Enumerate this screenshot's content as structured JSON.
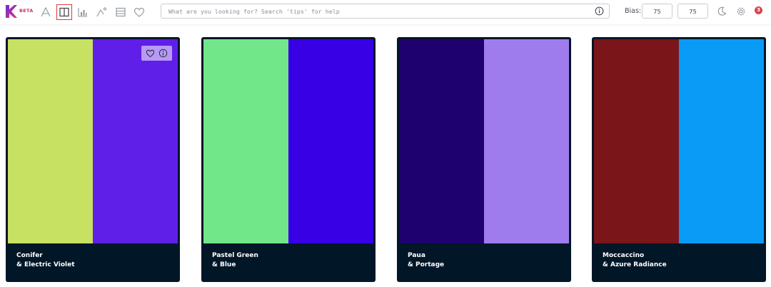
{
  "app": {
    "beta_label": "BETA",
    "brand_color": "#c8346a",
    "logo_icon": "k-logo-icon"
  },
  "toolbar": {
    "tools": [
      {
        "name": "typography-icon",
        "active": false
      },
      {
        "name": "two-column-palette-icon",
        "active": true
      },
      {
        "name": "chart-icon",
        "active": false
      },
      {
        "name": "gradient-icon",
        "active": false
      },
      {
        "name": "layout-icon",
        "active": false
      },
      {
        "name": "heart-icon",
        "active": false
      }
    ]
  },
  "search": {
    "placeholder": "What are you looking for? Search 'tips' for help",
    "value": ""
  },
  "bias": {
    "label": "Bias:",
    "value1": "75",
    "value2": "75"
  },
  "header_right": {
    "notification_count": "3",
    "badge_color": "#d9444d"
  },
  "cards": [
    {
      "name_line1": "Conifer",
      "name_line2": "& Electric Violet",
      "colors": [
        "#c7e162",
        "#5f1fe8"
      ],
      "show_actions": true
    },
    {
      "name_line1": "Pastel Green",
      "name_line2": "& Blue",
      "colors": [
        "#72e789",
        "#3800e5"
      ],
      "show_actions": false
    },
    {
      "name_line1": "Paua",
      "name_line2": "& Portage",
      "colors": [
        "#1e006e",
        "#9e7cee"
      ],
      "show_actions": false
    },
    {
      "name_line1": "Moccaccino",
      "name_line2": "& Azure Radiance",
      "colors": [
        "#7a1519",
        "#0a9bf7"
      ],
      "show_actions": false
    }
  ],
  "card_background": "#011627"
}
